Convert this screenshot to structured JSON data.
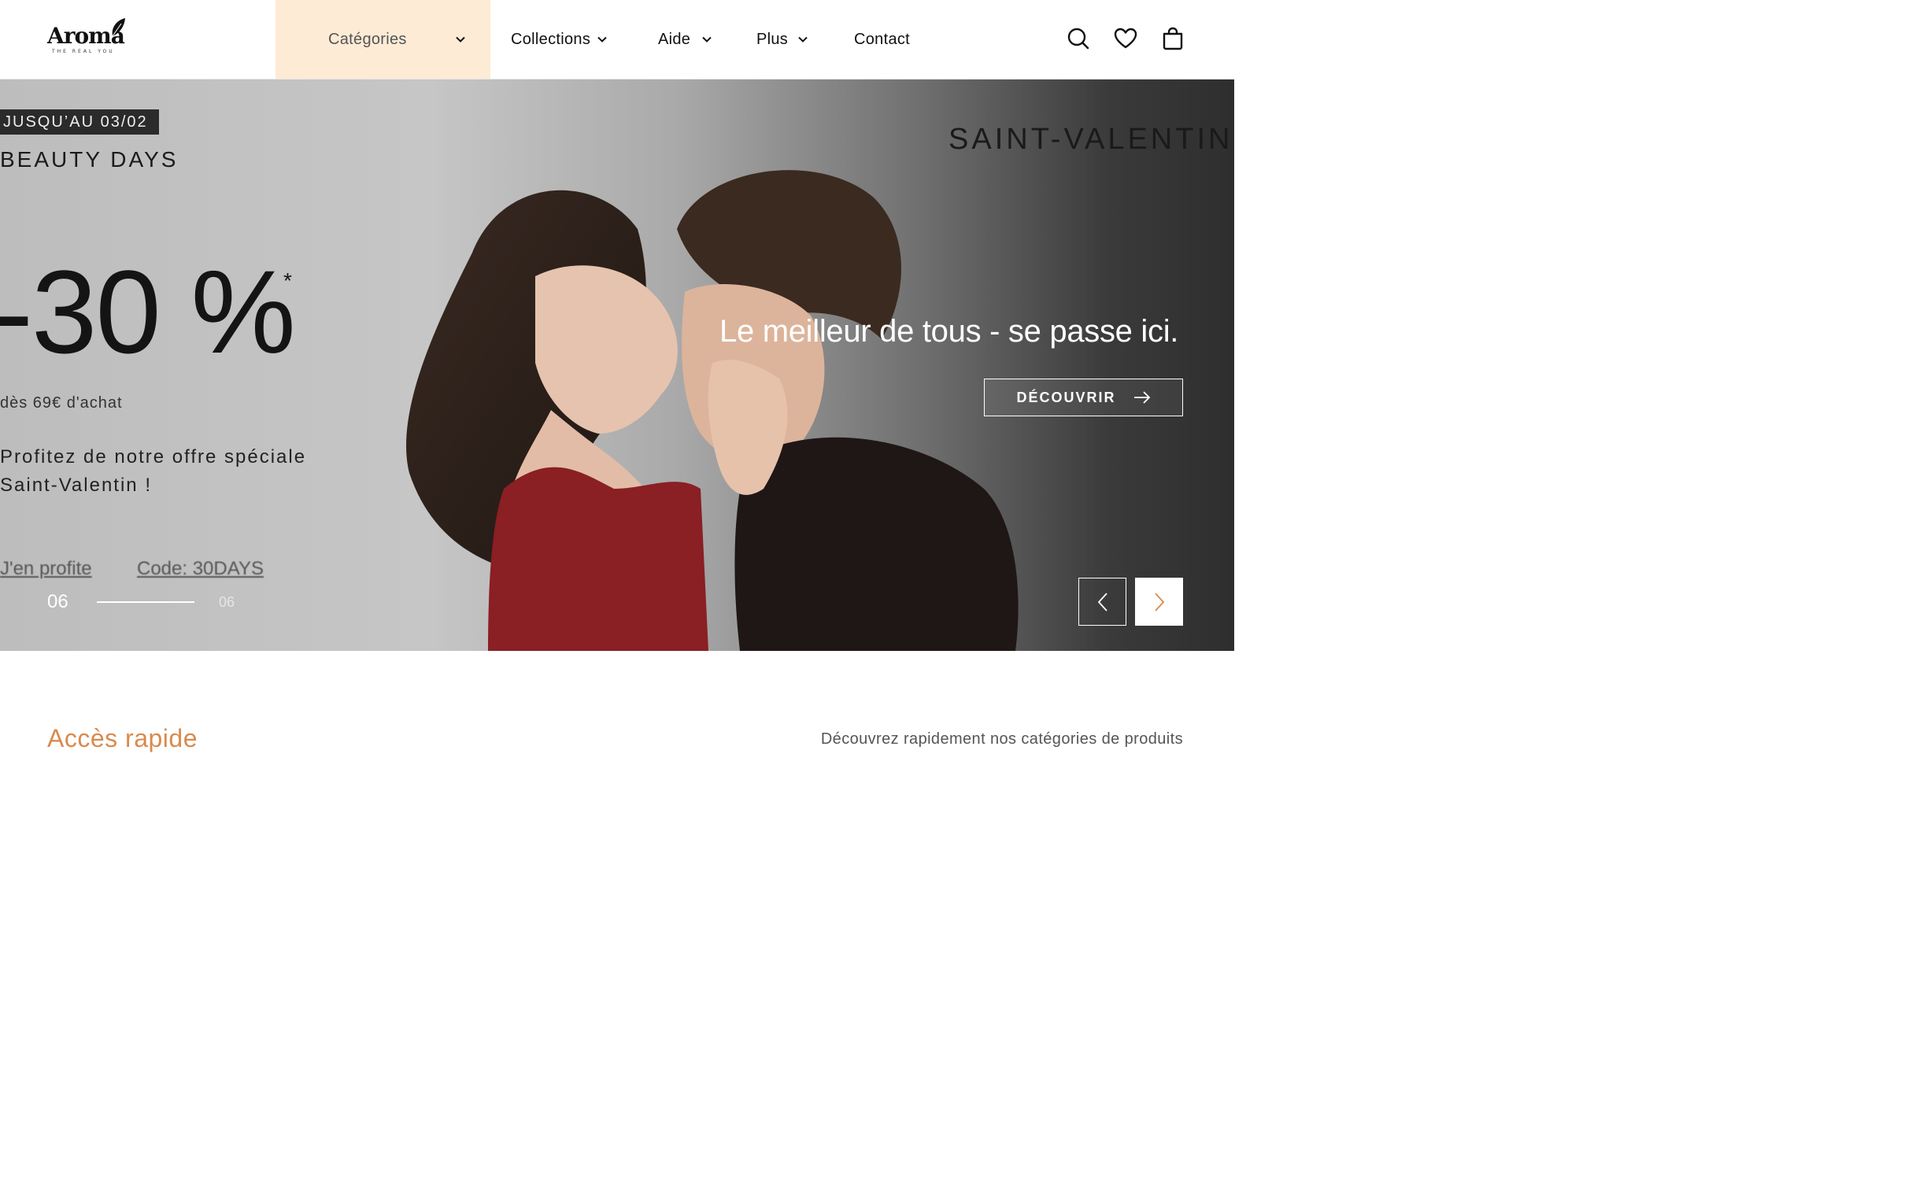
{
  "header": {
    "logo": {
      "name": "Aroma",
      "tagline": "THE REAL YOU"
    },
    "nav": {
      "categories": "Catégories",
      "collections": "Collections",
      "aide": "Aide",
      "plus": "Plus",
      "contact": "Contact"
    },
    "icons": [
      "search-icon",
      "heart-icon",
      "bag-icon"
    ]
  },
  "hero": {
    "promo": {
      "date": "JUSQU’AU 03/02",
      "event": "BEAUTY DAYS",
      "discount": "-30 %",
      "asterisk": "*",
      "minimum": "dès 69€ d'achat",
      "offer_line1": "Profitez de notre offre spéciale",
      "offer_line2": "Saint-Valentin !",
      "link": "J'en profite",
      "code": "Code: 30DAYS"
    },
    "badge": "SAINT-VALENTIN",
    "headline": "Le meilleur de tous - se passe ici.",
    "cta": "DÉCOUVRIR",
    "slider": {
      "current": "06",
      "total": "06"
    }
  },
  "quick_access": {
    "title": "Accès rapide",
    "subtitle": "Découvrez rapidement nos catégories de produits"
  },
  "colors": {
    "accent": "#d98a4e",
    "categories_bg": "#fdebd5",
    "dress_red": "#8a1f24"
  }
}
